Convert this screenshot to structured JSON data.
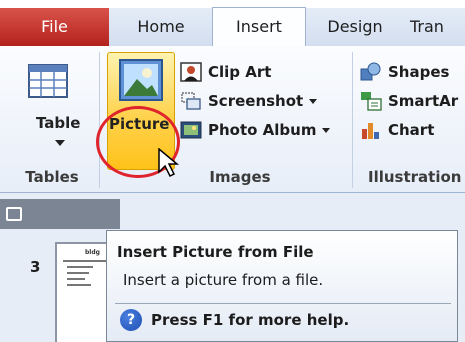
{
  "tabs": [
    {
      "id": "file",
      "label": "File"
    },
    {
      "id": "home",
      "label": "Home"
    },
    {
      "id": "insert",
      "label": "Insert"
    },
    {
      "id": "design",
      "label": "Design"
    },
    {
      "id": "transitions",
      "label": "Tran"
    }
  ],
  "groups": {
    "tables": {
      "label": "Tables",
      "table_label": "Table"
    },
    "images": {
      "label": "Images",
      "picture_label": "Picture",
      "clip_art": "Clip Art",
      "screenshot": "Screenshot",
      "photo_album": "Photo Album"
    },
    "illustrations": {
      "label": "Illustration",
      "shapes": "Shapes",
      "smartart": "SmartAr",
      "chart": "Chart"
    }
  },
  "slide_panel": {
    "slide_number": "3",
    "thumb_title": "bldg"
  },
  "tooltip": {
    "title": "Insert Picture from File",
    "description": "Insert a picture from a file.",
    "help": "Press F1 for more help.",
    "help_icon_glyph": "?"
  }
}
